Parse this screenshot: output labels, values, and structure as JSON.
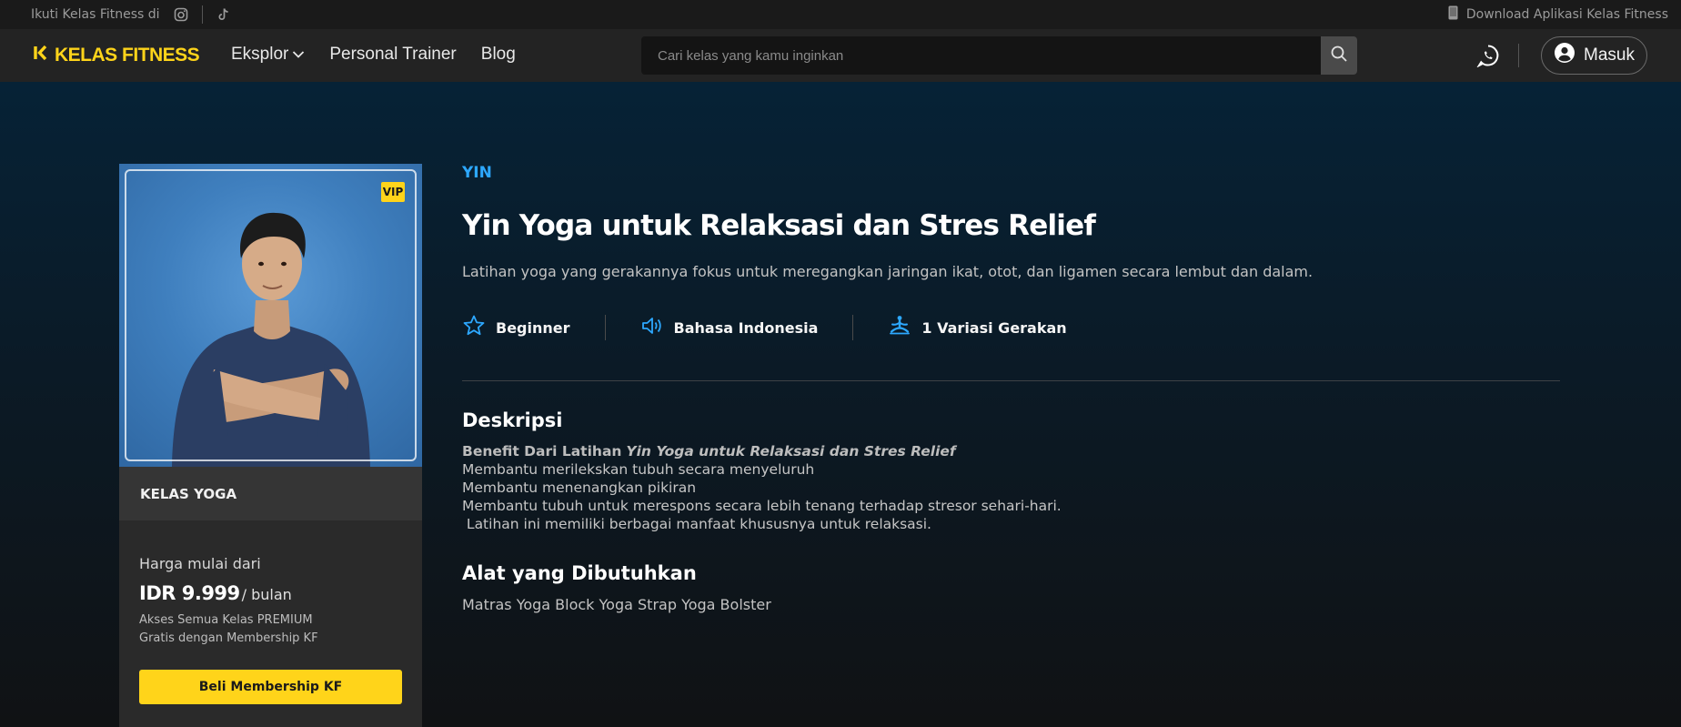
{
  "topstrip": {
    "follow_text": "Ikuti Kelas Fitness di",
    "download_text": "Download Aplikasi Kelas Fitness"
  },
  "navbar": {
    "logo_text": "KELAS FITNESS",
    "links": {
      "explore": "Eksplor",
      "personal_trainer": "Personal Trainer",
      "blog": "Blog"
    },
    "search_placeholder": "Cari kelas yang kamu inginkan",
    "login_label": "Masuk"
  },
  "card": {
    "badge": "VIP",
    "category": "KELAS YOGA",
    "price_label": "Harga mulai dari",
    "price": "IDR 9.999",
    "per_period": "/ bulan",
    "benefit_1": "Akses Semua Kelas PREMIUM",
    "benefit_2": "Gratis dengan Membership KF",
    "buy_button": "Beli Membership KF"
  },
  "class": {
    "tag": "YIN",
    "title": "Yin Yoga untuk Relaksasi dan Stres Relief",
    "subtitle": "Latihan yoga yang gerakannya fokus untuk meregangkan jaringan ikat, otot, dan ligamen secara lembut dan dalam.",
    "level": "Beginner",
    "language": "Bahasa Indonesia",
    "variations": "1 Variasi Gerakan"
  },
  "description": {
    "heading": "Deskripsi",
    "benefit_prefix": "Benefit Dari Latihan",
    "benefit_title": "Yin Yoga untuk Relaksasi dan Stres Relief",
    "lines": [
      "Membantu merilekskan tubuh secara menyeluruh",
      "Membantu menenangkan pikiran",
      "Membantu tubuh untuk merespons secara lebih tenang terhadap stresor sehari-hari.",
      " Latihan ini memiliki berbagai manfaat khususnya untuk relaksasi."
    ]
  },
  "equipment": {
    "heading": "Alat yang Dibutuhkan",
    "items": "Matras Yoga Block Yoga Strap Yoga Bolster"
  },
  "colors": {
    "brand_yellow": "#ffd41a",
    "accent_blue": "#2da8ff"
  }
}
